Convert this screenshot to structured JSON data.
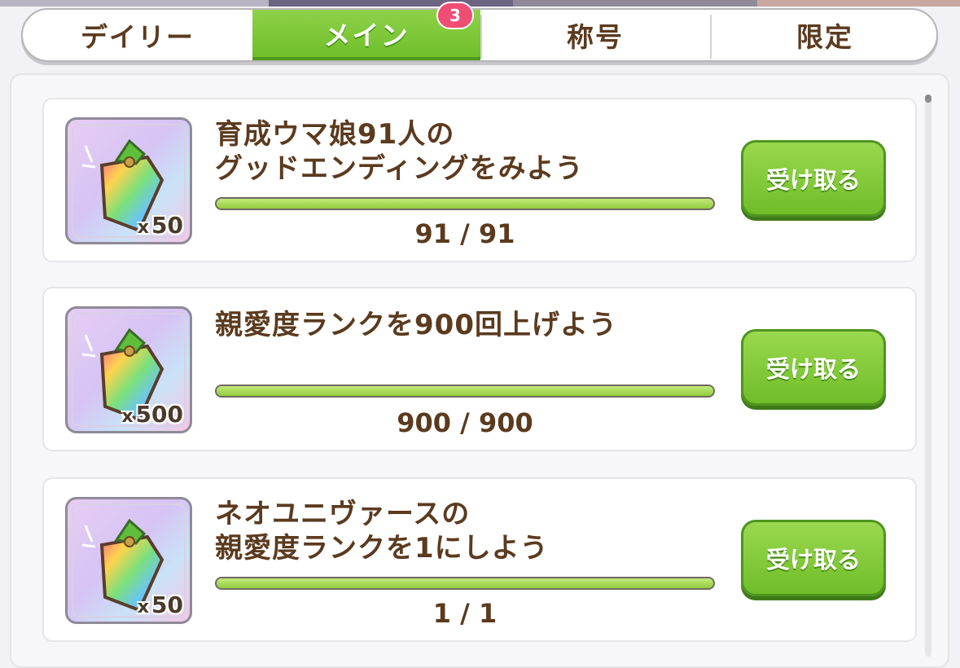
{
  "tabs": [
    {
      "label": "デイリー",
      "active": false
    },
    {
      "label": "メイン",
      "active": true,
      "badge": "3"
    },
    {
      "label": "称号",
      "active": false
    },
    {
      "label": "限定",
      "active": false
    }
  ],
  "missions": [
    {
      "title": "育成ウマ娘91人の\nグッドエンディングをみよう",
      "reward_icon": "rainbow-gem-icon",
      "quantity_prefix": "x",
      "quantity": "50",
      "progress_text": "91 / 91",
      "progress_fraction": 1.0,
      "button_label": "受け取る"
    },
    {
      "title": "親愛度ランクを900回上げよう",
      "reward_icon": "rainbow-gem-icon",
      "quantity_prefix": "x",
      "quantity": "500",
      "progress_text": "900 / 900",
      "progress_fraction": 1.0,
      "button_label": "受け取る"
    },
    {
      "title": "ネオユニヴァースの\n親愛度ランクを1にしよう",
      "reward_icon": "rainbow-gem-icon",
      "quantity_prefix": "x",
      "quantity": "50",
      "progress_text": "1 / 1",
      "progress_fraction": 1.0,
      "button_label": "受け取る"
    }
  ],
  "colors": {
    "accent_green": "#7cc63a",
    "text_brown": "#5b3a1e",
    "badge_pink": "#ef4d73"
  }
}
